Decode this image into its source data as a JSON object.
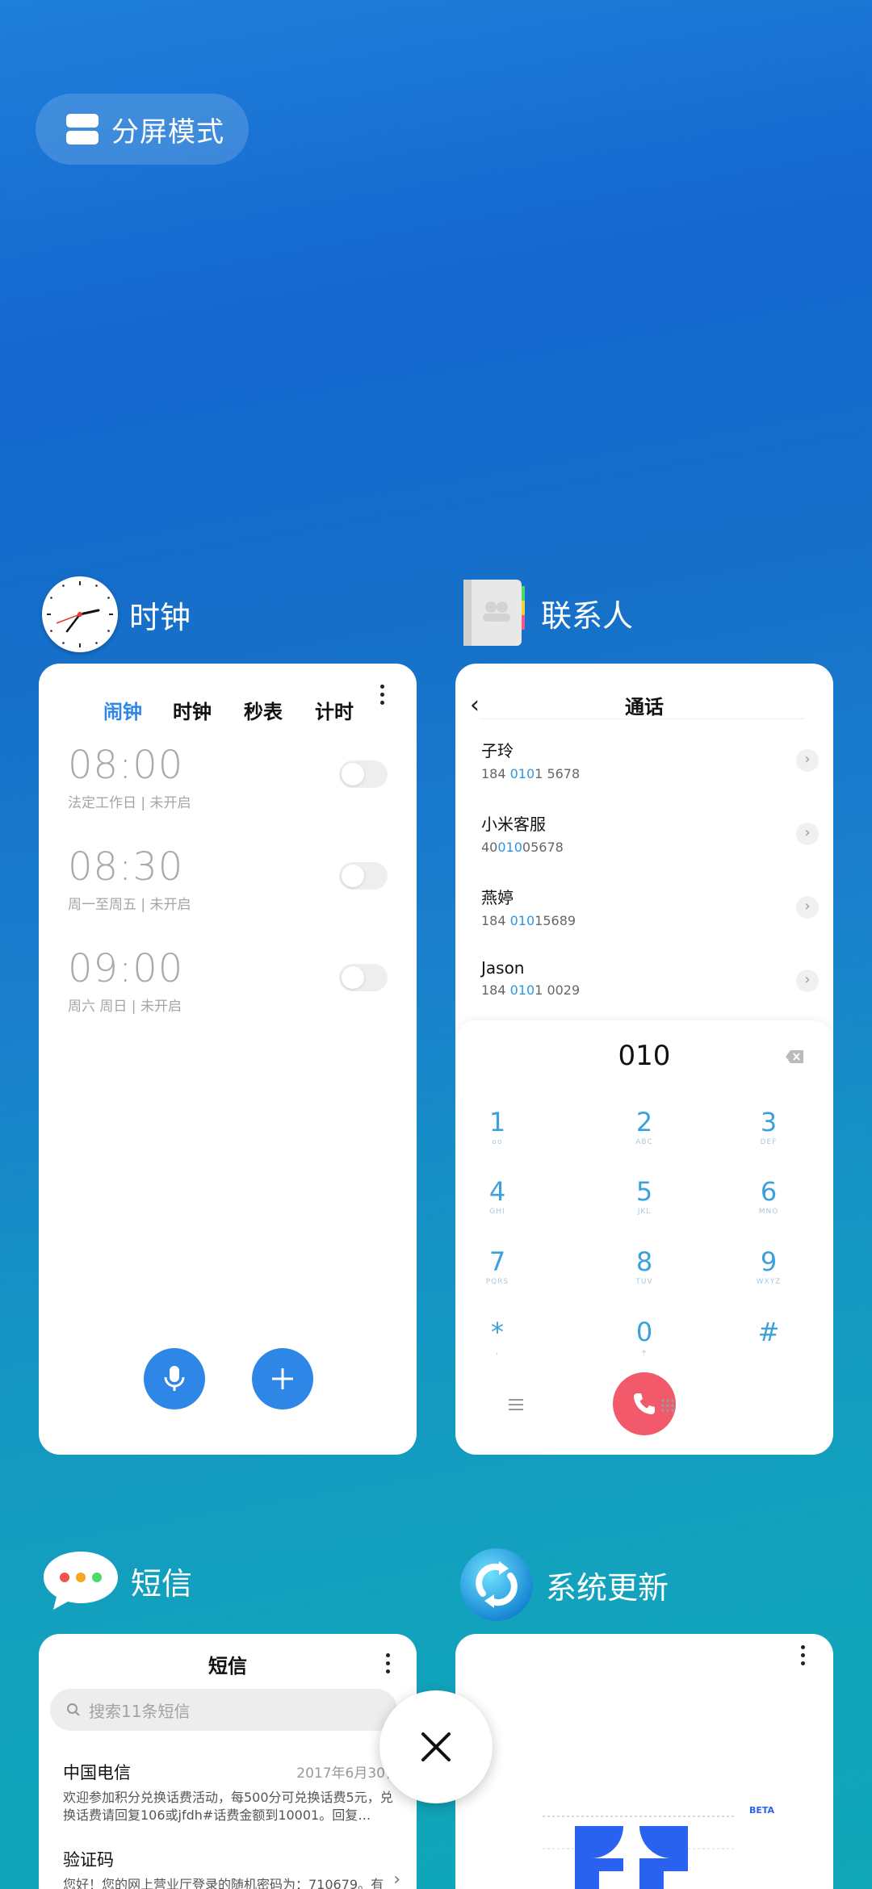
{
  "split_screen": {
    "label": "分屏模式"
  },
  "clock_app": {
    "title": "时钟",
    "tabs": [
      "闹钟",
      "时钟",
      "秒表",
      "计时"
    ],
    "alarms": [
      {
        "time": "08:00",
        "sub": "法定工作日 | 未开启"
      },
      {
        "time": "08:30",
        "sub": "周一至周五 | 未开启"
      },
      {
        "time": "09:00",
        "sub": "周六 周日 | 未开启"
      }
    ]
  },
  "contacts_app": {
    "title": "联系人",
    "screen_title": "通话",
    "entries": [
      {
        "name": "子玲",
        "num_pre": "184 ",
        "num_hl": "010",
        "num_post": "1 5678"
      },
      {
        "name": "小米客服",
        "num_pre": "40",
        "num_hl": "010",
        "num_post": "05678"
      },
      {
        "name": "燕婷",
        "num_pre": "184 ",
        "num_hl": "010",
        "num_post": "15689"
      },
      {
        "name": "Jason",
        "num_pre": "184 ",
        "num_hl": "010",
        "num_post": "1 0029"
      }
    ],
    "dial_input": "010",
    "keys": [
      {
        "d": "1",
        "l": "ᴏᴏ"
      },
      {
        "d": "2",
        "l": "ABC"
      },
      {
        "d": "3",
        "l": "DEF"
      },
      {
        "d": "4",
        "l": "GHI"
      },
      {
        "d": "5",
        "l": "JKL"
      },
      {
        "d": "6",
        "l": "MNO"
      },
      {
        "d": "7",
        "l": "PQRS"
      },
      {
        "d": "8",
        "l": "TUV"
      },
      {
        "d": "9",
        "l": "WXYZ"
      },
      {
        "d": "*",
        "l": ","
      },
      {
        "d": "0",
        "l": "+"
      },
      {
        "d": "#",
        "l": ""
      }
    ]
  },
  "messages_app": {
    "title": "短信",
    "screen_title": "短信",
    "search_placeholder": "搜索11条短信",
    "threads": [
      {
        "sender": "中国电信",
        "date": "2017年6月30日",
        "preview": "欢迎参加积分兑换话费活动，每500分可兑换话费5元，兑换话费请回复106或jfdh#话费金额到10001。回复…"
      },
      {
        "sender": "验证码",
        "date": "",
        "preview": "您好！您的网上营业厅登录的随机密码为：710679。有"
      }
    ]
  },
  "update_app": {
    "title": "系统更新",
    "badge": "BETA"
  }
}
